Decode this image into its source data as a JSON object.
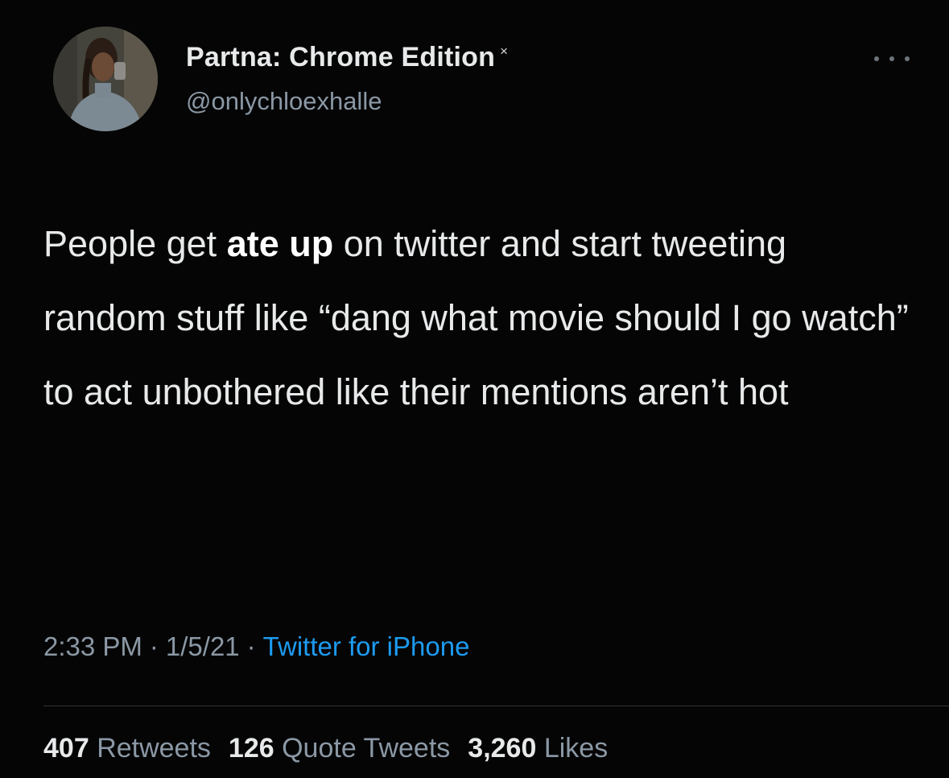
{
  "author": {
    "display_name": "Partna: Chrome Edition",
    "name_mark": "×",
    "handle": "@onlychloexhalle",
    "avatar_icon": "profile-photo"
  },
  "menu": {
    "icon": "more-dots-icon"
  },
  "tweet": {
    "text_before": "People get ",
    "text_bold": "ate up",
    "text_after": " on twitter and start tweeting random stuff like “dang what movie should I go watch” to act unbothered like their mentions aren’t hot"
  },
  "meta": {
    "time": "2:33 PM",
    "date": "1/5/21",
    "separator": "·",
    "source": "Twitter for iPhone"
  },
  "stats": {
    "retweets_count": "407",
    "retweets_label": "Retweets",
    "quotes_count": "126",
    "quotes_label": "Quote Tweets",
    "likes_count": "3,260",
    "likes_label": "Likes"
  },
  "colors": {
    "background": "#050505",
    "text": "#e7e9ea",
    "secondary": "#8b98a5",
    "link": "#1d9bf0"
  }
}
